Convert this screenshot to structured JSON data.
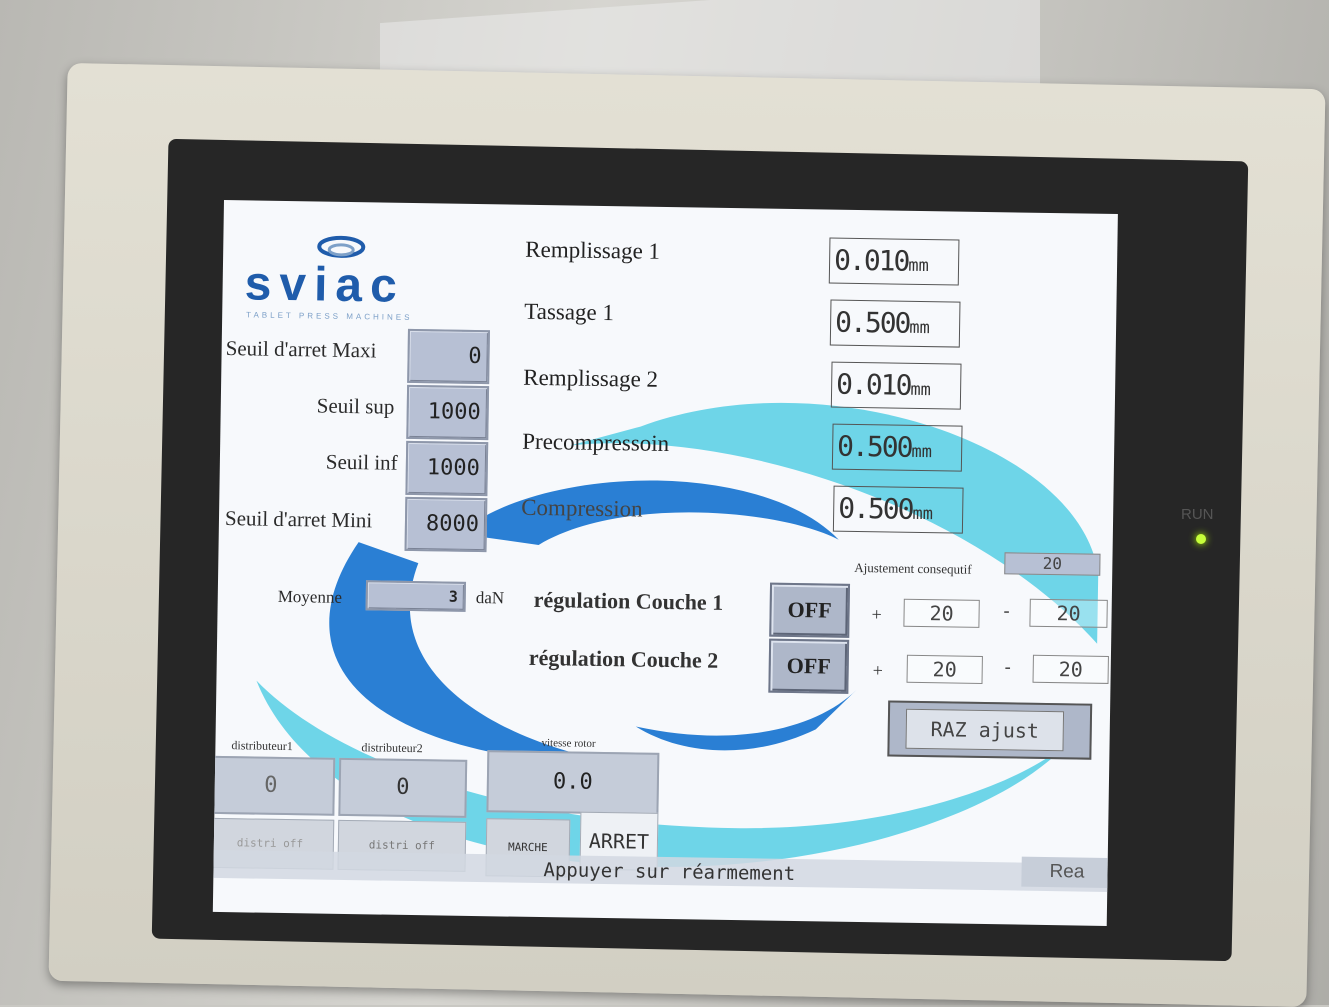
{
  "device": {
    "run_label": "RUN"
  },
  "logo": {
    "name": "sviac",
    "tagline": "TABLET PRESS MACHINES"
  },
  "thresholds": [
    {
      "label": "Seuil d'arret Maxi",
      "value": "0"
    },
    {
      "label": "Seuil sup",
      "value": "1000"
    },
    {
      "label": "Seuil inf",
      "value": "1000"
    },
    {
      "label": "Seuil d'arret Mini",
      "value": "8000"
    }
  ],
  "settings": [
    {
      "label": "Remplissage 1",
      "value": "0.010",
      "unit": "mm"
    },
    {
      "label": "Tassage 1",
      "value": "0.500",
      "unit": "mm"
    },
    {
      "label": "Remplissage 2",
      "value": "0.010",
      "unit": "mm"
    },
    {
      "label": "Precompressoin",
      "value": "0.500",
      "unit": "mm"
    },
    {
      "label": "Compression",
      "value": "0.500",
      "unit": "mm"
    }
  ],
  "adjust": {
    "label": "Ajustement consequtif",
    "value": "20"
  },
  "average": {
    "label": "Moyenne",
    "value": "3",
    "unit": "daN"
  },
  "regulation": [
    {
      "label": "régulation Couche 1",
      "state": "OFF",
      "plus_sign": "+",
      "plus": "20",
      "minus_sign": "-",
      "minus": "20"
    },
    {
      "label": "régulation  Couche 2",
      "state": "OFF",
      "plus_sign": "+",
      "plus": "20",
      "minus_sign": "-",
      "minus": "20"
    }
  ],
  "raz_button": "RAZ ajust",
  "distributors": [
    {
      "label": "distributeur1",
      "value": "0",
      "button": "distri off"
    },
    {
      "label": "distributeur2",
      "value": "0",
      "button": "distri off"
    }
  ],
  "rotor": {
    "label": "vitesse rotor",
    "value": "0.0",
    "start": "MARCHE",
    "stop": "ARRET"
  },
  "status": {
    "message": "Appuyer sur réarmement",
    "reset": "Rea"
  }
}
